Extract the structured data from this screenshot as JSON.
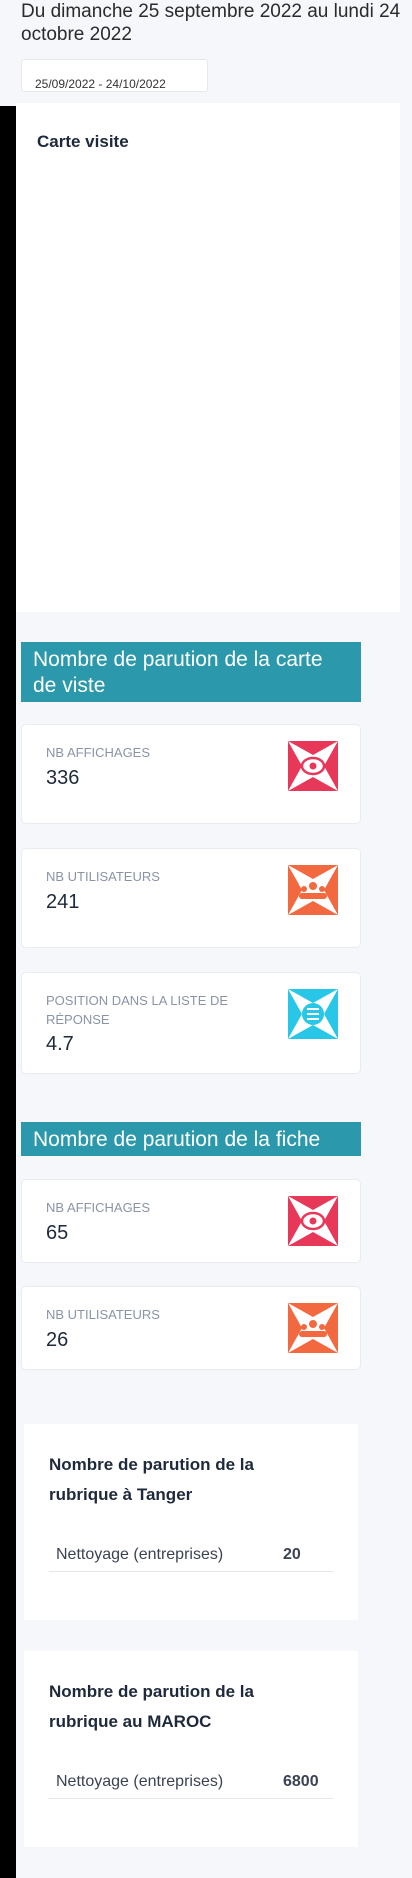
{
  "header": {
    "period_title": "Du dimanche 25 septembre 2022 au lundi 24 octobre 2022",
    "date_range": "25/09/2022 - 24/10/2022"
  },
  "map_card": {
    "title": "Carte visite"
  },
  "visit_card_section": {
    "title": "Nombre de parution de la carte de viste",
    "kpis": [
      {
        "label": "NB AFFICHAGES",
        "value": "336",
        "icon": "eye-icon",
        "color": "#e8385a"
      },
      {
        "label": "NB UTILISATEURS",
        "value": "241",
        "icon": "users-icon",
        "color": "#f2683f"
      },
      {
        "label": "POSITION DANS LA LISTE DE RÉPONSE",
        "value": "4.7",
        "icon": "list-icon",
        "color": "#28c7e8"
      }
    ]
  },
  "fiche_section": {
    "title": "Nombre de parution de la fiche",
    "kpis": [
      {
        "label": "NB AFFICHAGES",
        "value": "65",
        "icon": "eye-icon",
        "color": "#e8385a"
      },
      {
        "label": "NB UTILISATEURS",
        "value": "26",
        "icon": "users-icon",
        "color": "#f2683f"
      }
    ]
  },
  "rubrique_tanger": {
    "title": "Nombre de parution de la rubrique à Tanger",
    "rows": [
      {
        "label": "Nettoyage (entreprises)",
        "value": "20"
      }
    ]
  },
  "rubrique_maroc": {
    "title": "Nombre de parution de la rubrique au MAROC",
    "rows": [
      {
        "label": "Nettoyage (entreprises)",
        "value": "6800"
      }
    ]
  },
  "colors": {
    "banner": "#2b99ab",
    "eye": "#e8385a",
    "users": "#f2683f",
    "list": "#28c7e8"
  }
}
